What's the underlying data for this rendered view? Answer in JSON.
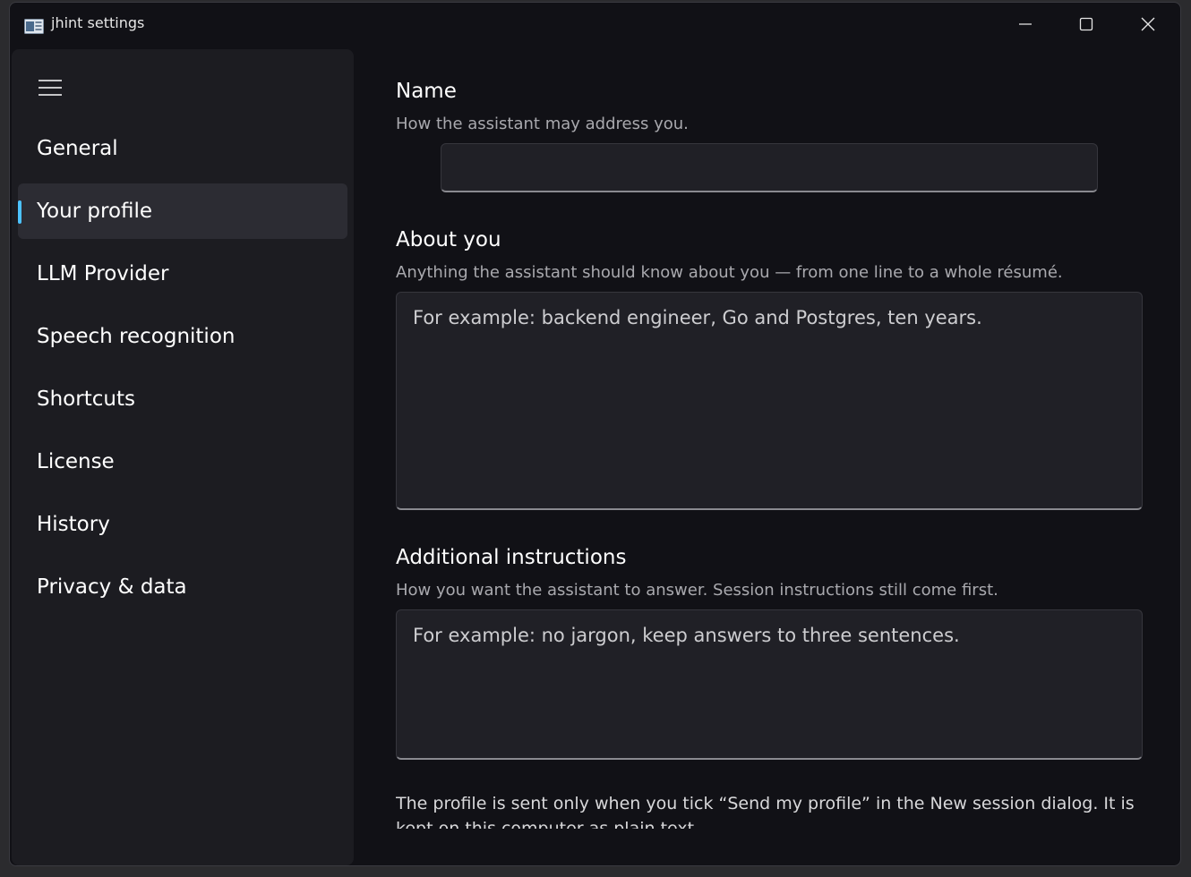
{
  "window": {
    "title": "jhint settings"
  },
  "sidebar": {
    "items": [
      {
        "label": "General"
      },
      {
        "label": "Your profile",
        "active": true
      },
      {
        "label": "LLM Provider"
      },
      {
        "label": "Speech recognition"
      },
      {
        "label": "Shortcuts"
      },
      {
        "label": "License"
      },
      {
        "label": "History"
      },
      {
        "label": "Privacy & data"
      }
    ]
  },
  "profile": {
    "name": {
      "heading": "Name",
      "description": "How the assistant may address you.",
      "value": "",
      "placeholder": ""
    },
    "about": {
      "heading": "About you",
      "description": "Anything the assistant should know about you — from one line to a whole résumé.",
      "value": "",
      "placeholder": "For example: backend engineer, Go and Postgres, ten years."
    },
    "instructions": {
      "heading": "Additional instructions",
      "description": "How you want the assistant to answer. Session instructions still come first.",
      "value": "",
      "placeholder": "For example: no jargon, keep answers to three sentences."
    },
    "footer_note": "The profile is sent only when you tick “Send my profile” in the New session dialog. It is kept on this computer as plain text."
  },
  "colors": {
    "accent": "#4cc2ff",
    "window_bg": "#111116",
    "sidebar_bg": "#1c1c21",
    "field_bg": "#202026"
  }
}
